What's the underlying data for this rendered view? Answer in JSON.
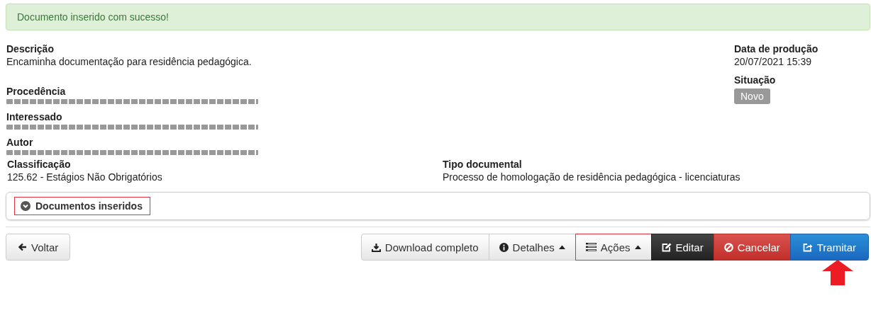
{
  "alert": {
    "text": "Documento inserido com sucesso!"
  },
  "fields": [
    {
      "label": "Descrição",
      "value": "Encaminha documentação para residência pedagógica."
    },
    {
      "label": "Procedência",
      "kind": "redacted"
    },
    {
      "label": "Interessado",
      "kind": "redacted"
    },
    {
      "label": "Autor",
      "kind": "redacted"
    }
  ],
  "classification": {
    "label": "Classificação",
    "value": "125.62 - Estágios Não Obrigatórios"
  },
  "document_type": {
    "label": "Tipo documental",
    "value": "Processo de homologação de residência pedagógica - licenciaturas"
  },
  "production_date": {
    "label": "Data de produção",
    "value": "20/07/2021 15:39"
  },
  "status": {
    "label": "Situação",
    "badge": "Novo"
  },
  "section": {
    "title": "Documentos inseridos",
    "expanded": false,
    "highlighted": true
  },
  "back_button": {
    "label": "Voltar"
  },
  "buttons": [
    {
      "label": "Download completo",
      "kind": "download",
      "caret": false,
      "highlighted": false,
      "arrow": false
    },
    {
      "label": "Detalhes",
      "kind": "info",
      "caret": true,
      "highlighted": false,
      "arrow": false
    },
    {
      "label": "Ações",
      "kind": "list",
      "caret": true,
      "highlighted": true,
      "arrow": false
    },
    {
      "label": "Editar",
      "kind": "edit",
      "caret": false,
      "highlighted": false,
      "arrow": false
    },
    {
      "label": "Cancelar",
      "kind": "cancel",
      "caret": false,
      "highlighted": false,
      "arrow": false
    },
    {
      "label": "Tramitar",
      "kind": "share",
      "caret": false,
      "highlighted": false,
      "arrow": true
    }
  ]
}
